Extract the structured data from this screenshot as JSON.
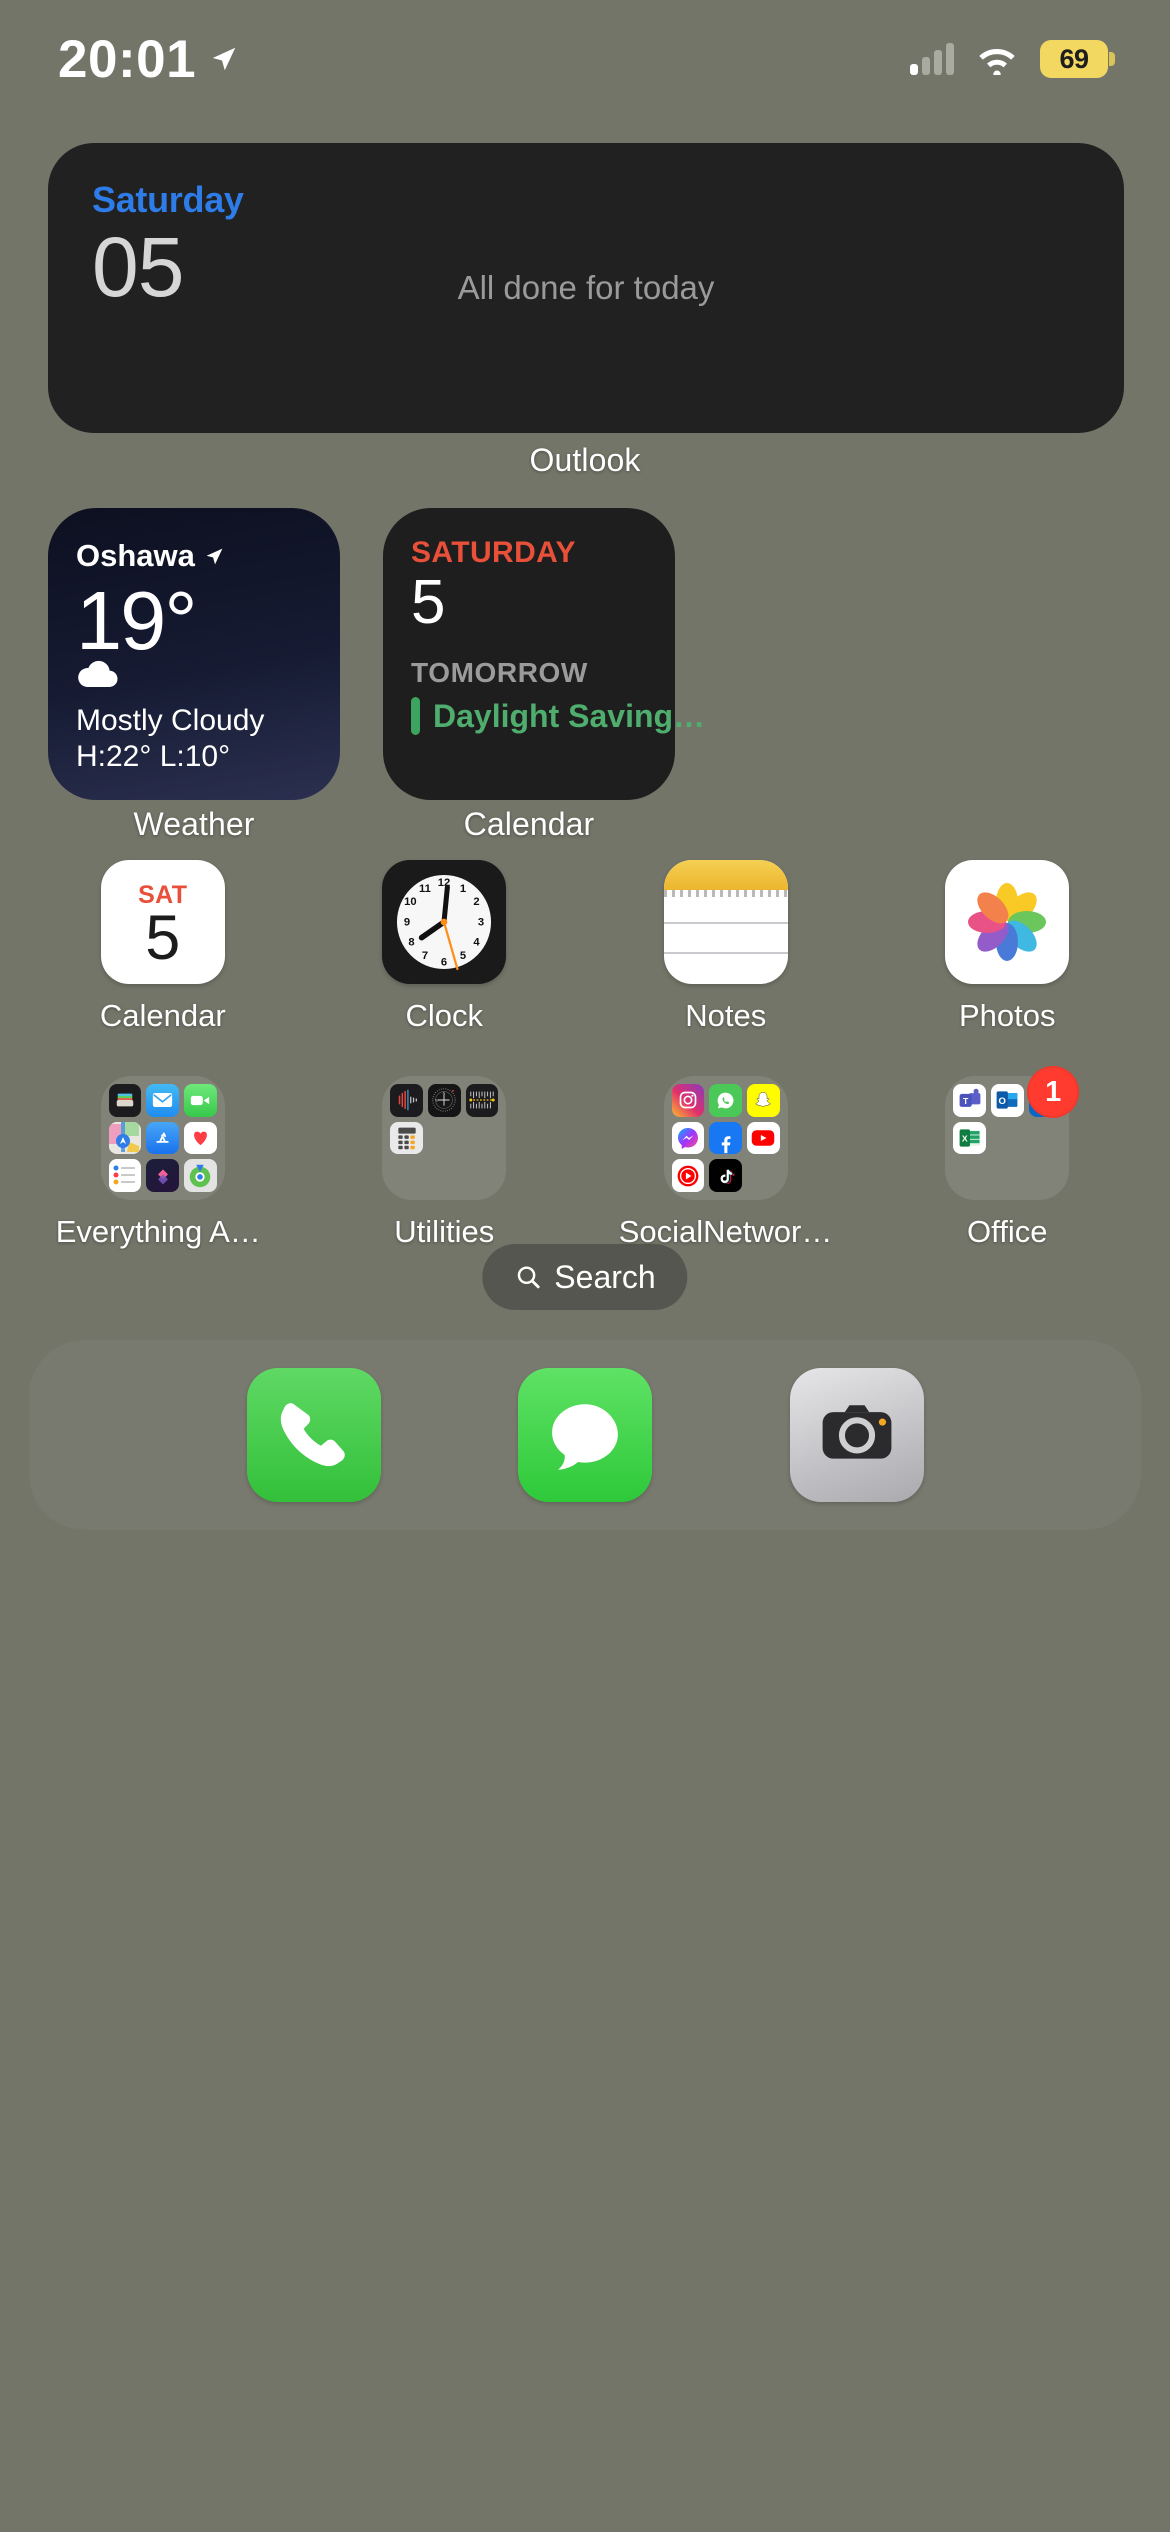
{
  "status_bar": {
    "time": "20:01",
    "location_icon": "location-arrow-icon",
    "cellular_icon": "cellular-signal-icon",
    "wifi_icon": "wifi-icon",
    "battery_level": "69",
    "battery_color": "#f2d861"
  },
  "widgets": {
    "outlook": {
      "label": "Outlook",
      "day": "Saturday",
      "date": "05",
      "empty_state": "All done for today",
      "day_color": "#2e7ce8",
      "background": "#212121"
    },
    "weather": {
      "label": "Weather",
      "city": "Oshawa",
      "location_icon": "location-arrow-icon",
      "temperature": "19°",
      "condition_icon": "cloud-icon",
      "condition": "Mostly Cloudy",
      "high_low": "H:22° L:10°"
    },
    "calendar": {
      "label": "Calendar",
      "day_of_week": "SATURDAY",
      "day_number": "5",
      "section": "TOMORROW",
      "event": "Daylight Saving…",
      "dow_color": "#e8503a",
      "event_color": "#4fae6d"
    }
  },
  "apps_row": [
    {
      "name": "Calendar",
      "icon": "calendar-app-icon",
      "day": "SAT",
      "date": "5"
    },
    {
      "name": "Clock",
      "icon": "clock-app-icon"
    },
    {
      "name": "Notes",
      "icon": "notes-app-icon"
    },
    {
      "name": "Photos",
      "icon": "photos-app-icon"
    }
  ],
  "folders_row": [
    {
      "name": "Everything Apple",
      "apps": [
        "Wallet",
        "Mail",
        "FaceTime",
        "Maps",
        "App Store",
        "Health",
        "Reminders",
        "Shortcuts",
        "Find My"
      ]
    },
    {
      "name": "Utilities",
      "apps": [
        "Voice Memos",
        "Compass",
        "Measure",
        "Calculator"
      ]
    },
    {
      "name": "SocialNetworki...",
      "apps": [
        "Instagram",
        "WhatsApp",
        "Snapchat",
        "Messenger",
        "Facebook",
        "YouTube",
        "YouTube Music",
        "TikTok"
      ]
    },
    {
      "name": "Office",
      "apps": [
        "Teams",
        "Outlook",
        "LinkedIn",
        "Excel"
      ],
      "badge": "1",
      "badge_color": "#ff3b30"
    }
  ],
  "search": {
    "label": "Search",
    "icon": "search-icon"
  },
  "dock": [
    {
      "name": "Phone",
      "icon": "phone-icon"
    },
    {
      "name": "Messages",
      "icon": "messages-icon"
    },
    {
      "name": "Camera",
      "icon": "camera-icon"
    }
  ]
}
